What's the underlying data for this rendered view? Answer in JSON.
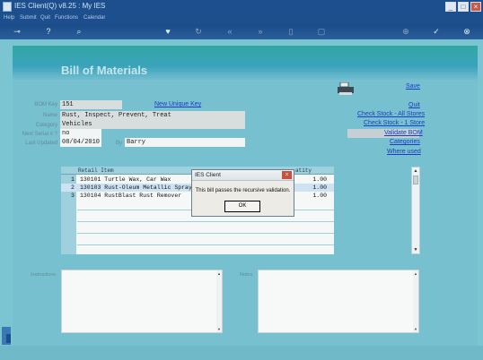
{
  "window": {
    "title": "IES Client(Q) v8.25 : My IES"
  },
  "menu": [
    "Help",
    "Submit",
    "Quit",
    "Functions",
    "Calendar"
  ],
  "page": {
    "title": "Bill of Materials"
  },
  "form": {
    "bom_key_label": "BOM Key",
    "bom_key": "151",
    "name_label": "Name",
    "name": "Rust, Inspect, Prevent, Treat",
    "category_label": "Category",
    "category": "Vehicles",
    "next_serial_label": "Next Serial # ?",
    "next_serial": "no",
    "last_updated_label": "Last Updated",
    "last_updated": "08/04/2010",
    "by_label": "By",
    "by": "Barry"
  },
  "links": {
    "new_unique_key": "New Unique Key",
    "save": "Save",
    "quit": "Quit",
    "check_stock_all": "Check Stock - All Stores",
    "check_stock_one": "Check Stock - 1 Store",
    "validate_bom": "Validate BOM",
    "categories": "Categories",
    "where_used": "Where used"
  },
  "grid": {
    "col_item": "Retail Item",
    "col_qty": "atity",
    "rows": [
      {
        "num": "1",
        "item": "130101 Turtle Wax, Car Wax",
        "qty": "1.00"
      },
      {
        "num": "2",
        "item": "130103 Rust-Oleum Metallic Spray,",
        "qty": "1.00"
      },
      {
        "num": "3",
        "item": "130104 RustBlast Rust Remover",
        "qty": "1.00"
      }
    ]
  },
  "dialog": {
    "title": "IES Client",
    "message": "This bill passes the recursive validation.",
    "ok": "OK"
  },
  "instructions_label": "Instructions",
  "notes_label": "Notes",
  "colors": {
    "title_bar": "#1d4f8e",
    "panel": "#77c0cf",
    "link": "#1d3cc5"
  }
}
